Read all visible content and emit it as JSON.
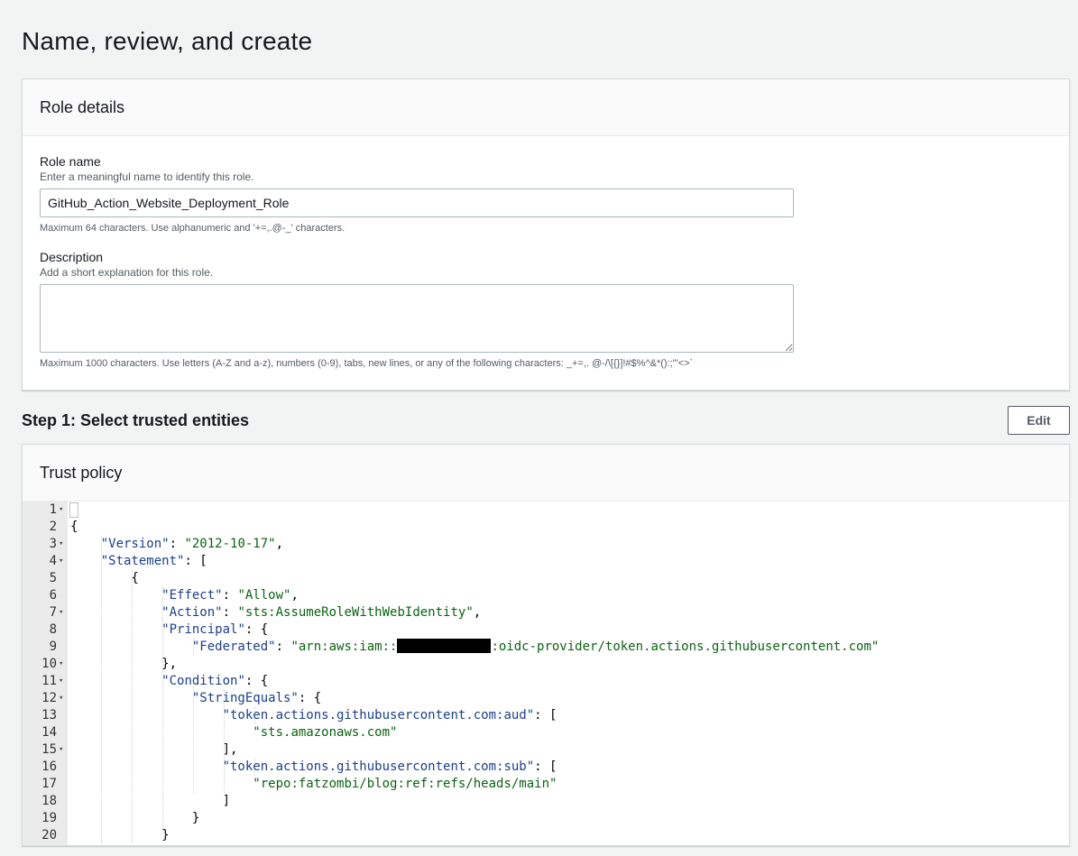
{
  "page": {
    "title": "Name, review, and create"
  },
  "role_details": {
    "header": "Role details",
    "role_name": {
      "label": "Role name",
      "description": "Enter a meaningful name to identify this role.",
      "value": "GitHub_Action_Website_Deployment_Role",
      "constraint": "Maximum 64 characters. Use alphanumeric and '+=,.@-_' characters."
    },
    "description": {
      "label": "Description",
      "description": "Add a short explanation for this role.",
      "value": "",
      "constraint": "Maximum 1000 characters. Use letters (A-Z and a-z), numbers (0-9), tabs, new lines, or any of the following characters: _+=,. @-/\\[{}]!#$%^&*():;\"'<>`"
    }
  },
  "step1": {
    "title": "Step 1: Select trusted entities",
    "edit_label": "Edit"
  },
  "trust_policy": {
    "header": "Trust policy",
    "lines": [
      {
        "n": "1",
        "fold": true
      },
      {
        "n": "2",
        "fold": false
      },
      {
        "n": "3",
        "fold": true
      },
      {
        "n": "4",
        "fold": true
      },
      {
        "n": "5",
        "fold": false
      },
      {
        "n": "6",
        "fold": false
      },
      {
        "n": "7",
        "fold": true
      },
      {
        "n": "8",
        "fold": false
      },
      {
        "n": "9",
        "fold": false
      },
      {
        "n": "10",
        "fold": true
      },
      {
        "n": "11",
        "fold": true
      },
      {
        "n": "12",
        "fold": true
      },
      {
        "n": "13",
        "fold": false
      },
      {
        "n": "14",
        "fold": false
      },
      {
        "n": "15",
        "fold": true
      },
      {
        "n": "16",
        "fold": false
      },
      {
        "n": "17",
        "fold": false
      },
      {
        "n": "18",
        "fold": false
      },
      {
        "n": "19",
        "fold": false
      },
      {
        "n": "20",
        "fold": false
      }
    ],
    "tokens": {
      "version_key": "\"Version\"",
      "version_val": "\"2012-10-17\"",
      "statement_key": "\"Statement\"",
      "effect_key": "\"Effect\"",
      "effect_val": "\"Allow\"",
      "action_key": "\"Action\"",
      "action_val": "\"sts:AssumeRoleWithWebIdentity\"",
      "principal_key": "\"Principal\"",
      "federated_key": "\"Federated\"",
      "federated_val_pre": "\"arn:aws:iam::",
      "federated_val_post": ":oidc-provider/token.actions.githubusercontent.com\"",
      "condition_key": "\"Condition\"",
      "stringequals_key": "\"StringEquals\"",
      "aud_key": "\"token.actions.githubusercontent.com:aud\"",
      "aud_val": "\"sts.amazonaws.com\"",
      "sub_key": "\"token.actions.githubusercontent.com:sub\"",
      "sub_val": "\"repo:fatzombi/blog:ref:refs/heads/main\""
    }
  }
}
